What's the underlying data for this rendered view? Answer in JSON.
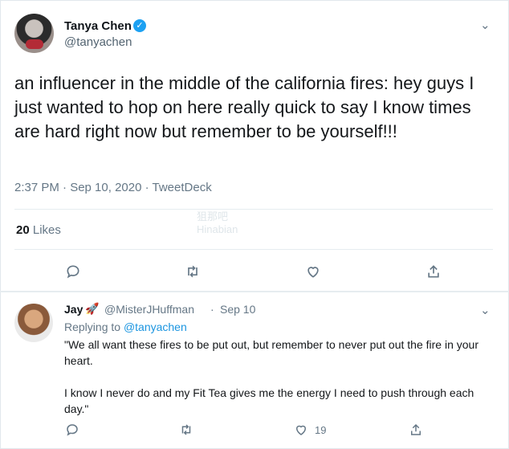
{
  "main_tweet": {
    "author_name": "Tanya Chen",
    "author_handle": "@tanyachen",
    "text": "an influencer in the middle of the california fires: hey guys I just wanted to hop on here really quick to say I know times are hard right now but remember to be yourself!!!",
    "timestamp": "2:37 PM · Sep 10, 2020 · TweetDeck",
    "likes_count": "20",
    "likes_label": "Likes",
    "watermark_line1": "狙那吧",
    "watermark_line2": "Hinabian"
  },
  "reply": {
    "author_name": "Jay",
    "author_emoji": "🚀",
    "author_handle": "@MisterJHuffman",
    "separator": "·",
    "date": "Sep 10",
    "replying_to_label": "Replying to",
    "replying_to_handle": "@tanyachen",
    "text": "\"We all want these fires to be put out, but remember to never put out the fire in your heart.\n\nI know I never do and my Fit Tea gives me the energy I need to push through each day.\"",
    "likes_count": "19"
  },
  "icons": {
    "verified": "verified-badge-icon",
    "caret": "chevron-down-icon",
    "reply": "reply-icon",
    "retweet": "retweet-icon",
    "like": "heart-icon",
    "share": "share-icon"
  },
  "colors": {
    "accent": "#1da1f2",
    "link": "#1b95e0",
    "secondary_text": "#657786"
  }
}
